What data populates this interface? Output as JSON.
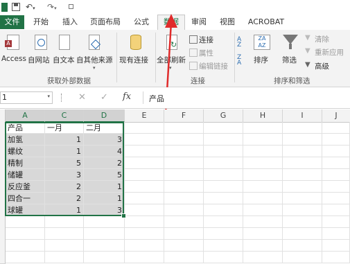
{
  "quick_access": {
    "excel_icon": "excel-icon",
    "save_icon": "save-icon",
    "undo_icon": "undo-icon",
    "redo_icon": "redo-icon",
    "customize": "▫"
  },
  "tabs": [
    {
      "label": "文件",
      "state": "file"
    },
    {
      "label": "开始",
      "state": ""
    },
    {
      "label": "插入",
      "state": ""
    },
    {
      "label": "页面布局",
      "state": ""
    },
    {
      "label": "公式",
      "state": ""
    },
    {
      "label": "数据",
      "state": "active"
    },
    {
      "label": "审阅",
      "state": ""
    },
    {
      "label": "视图",
      "state": ""
    },
    {
      "label": "ACROBAT",
      "state": ""
    }
  ],
  "ribbon": {
    "external": {
      "access": "Access",
      "web": "自网站",
      "text": "自文本",
      "other": "自其他来源",
      "existing": "现有连接",
      "group": "获取外部数据"
    },
    "connections": {
      "refresh": "全部刷新",
      "connect": "连接",
      "props": "属性",
      "edit_links": "编辑链接",
      "group": "连接"
    },
    "sort": {
      "sort": "排序",
      "filter": "筛选",
      "clear": "清除",
      "reapply": "重新应用",
      "advanced": "高级",
      "group": "排序和筛选"
    }
  },
  "formula_bar": {
    "name_box": "1",
    "cancel": "✕",
    "enter": "✓",
    "fx": "fx",
    "content": "产品"
  },
  "columns": [
    "A",
    "C",
    "D",
    "E",
    "F",
    "G",
    "H",
    "I",
    "J"
  ],
  "table": {
    "header": [
      "产品",
      "一月",
      "二月"
    ],
    "rows": [
      [
        "加氢",
        "1",
        "3"
      ],
      [
        "螺纹",
        "1",
        "4"
      ],
      [
        "精制",
        "5",
        "2"
      ],
      [
        "储罐",
        "3",
        "5"
      ],
      [
        "反应釜",
        "2",
        "1"
      ],
      [
        "四合一",
        "2",
        "1"
      ],
      [
        "球罐",
        "1",
        "3"
      ]
    ]
  },
  "colors": {
    "accent": "#217346",
    "arrow": "#e02b2b",
    "selection": "#d8d8d8"
  }
}
